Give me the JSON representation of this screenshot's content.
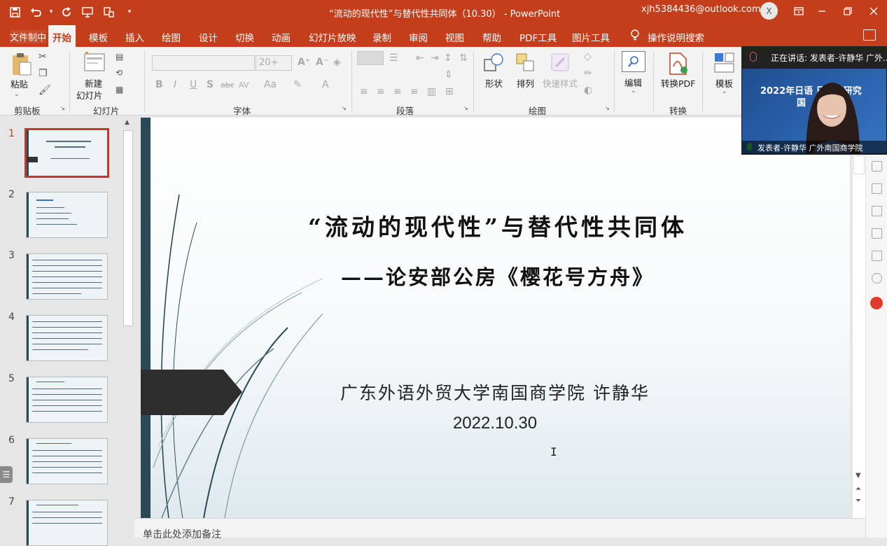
{
  "titlebar": {
    "title": "“流动的现代性”与替代性共同体（10.30）  -  PowerPoint",
    "account": "xjh5384436@outlook.com",
    "avatar": "X",
    "qat": [
      "save-icon",
      "undo-icon",
      "redo-icon",
      "present-icon",
      "layout-icon",
      "customize-icon"
    ]
  },
  "tabs": {
    "overlay": "文件制中",
    "items": [
      "开始",
      "模板",
      "插入",
      "绘图",
      "设计",
      "切换",
      "动画",
      "幻灯片放映",
      "录制",
      "审阅",
      "视图",
      "帮助",
      "PDF工具",
      "图片工具"
    ],
    "active": "开始",
    "tell_me": "操作说明搜索"
  },
  "ribbon": {
    "clipboard": {
      "label": "剪贴板",
      "paste": "粘贴"
    },
    "slides": {
      "label": "幻灯片",
      "new_slide": "新建",
      "new_slide2": "幻灯片"
    },
    "font": {
      "label": "字体",
      "size": "20+",
      "buttons": [
        "B",
        "I",
        "U",
        "S",
        "abc",
        "AV",
        "Aa",
        "A"
      ]
    },
    "paragraph": {
      "label": "段落"
    },
    "drawing": {
      "label": "绘图",
      "shape": "形状",
      "arrange": "排列",
      "quick_styles": "快速样式"
    },
    "editing": {
      "label": "编辑"
    },
    "convert": {
      "label": "转换",
      "to_pdf": "转换PDF"
    },
    "templates": {
      "label": "模板"
    }
  },
  "thumbnails": {
    "numbers": [
      "1",
      "2",
      "3",
      "4",
      "5",
      "6",
      "7"
    ],
    "active": "1"
  },
  "slide": {
    "title": "“流动的现代性”与替代性共同体",
    "subtitle": "——论安部公房《樱花号方舟》",
    "author": "广东外语外贸大学南国商学院  许静华",
    "date": "2022.10.30"
  },
  "notes": {
    "placeholder": "单击此处添加备注"
  },
  "meeting": {
    "speaking": "正在讲话: 发表者-许静华 广外...",
    "video_heading": "2022年日语    日本学研究",
    "video_heading2": "国",
    "presenter": "发表者-许静华  广外南国商学院"
  },
  "colors": {
    "accent": "#c43e1c",
    "slide_bar": "#2a4a55",
    "active_thumb_border": "#c0392b"
  }
}
